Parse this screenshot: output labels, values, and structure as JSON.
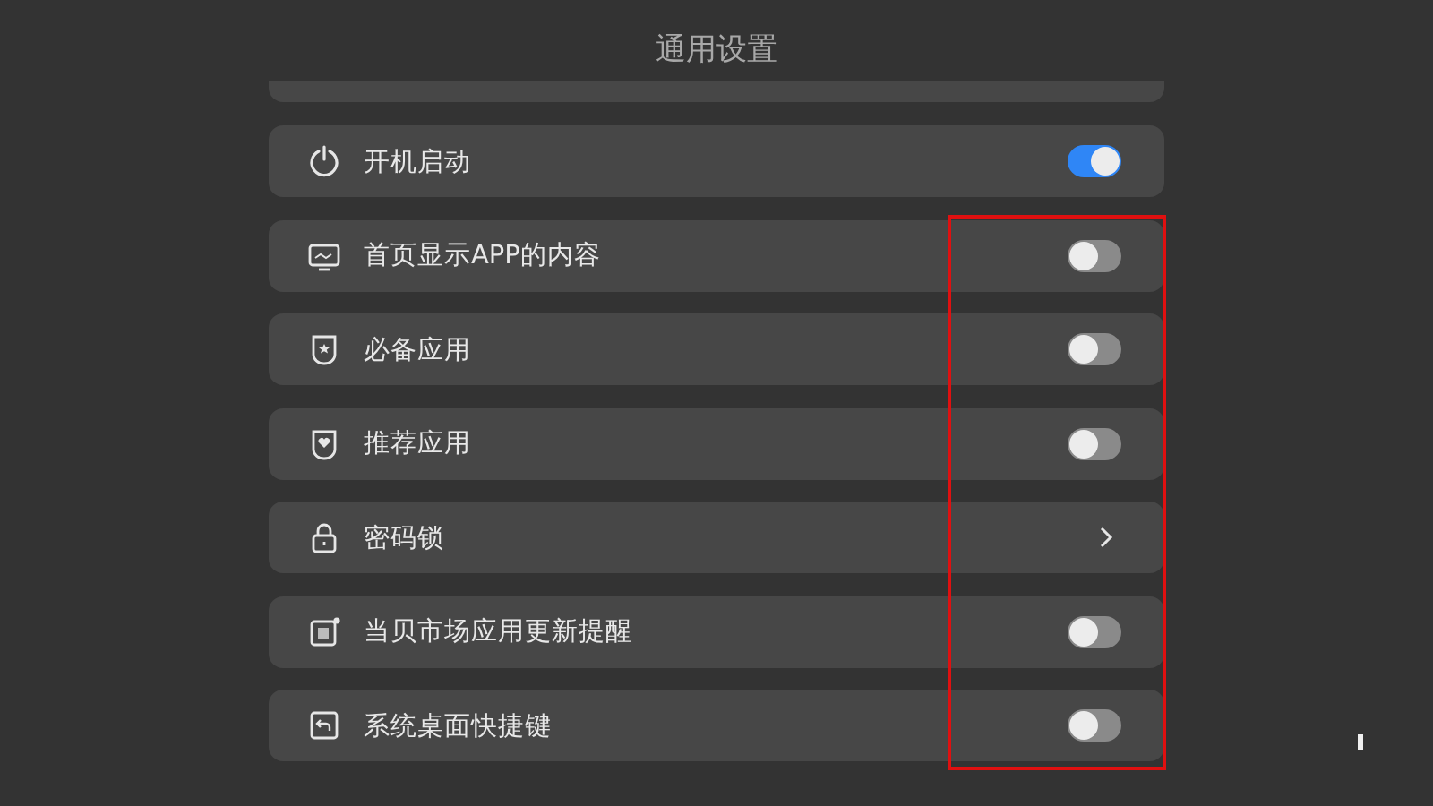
{
  "title": "通用设置",
  "items": [
    {
      "kind": "toggle",
      "label": "开机启动",
      "on": true
    },
    {
      "kind": "toggle",
      "label": "首页显示APP的内容",
      "on": false
    },
    {
      "kind": "toggle",
      "label": "必备应用",
      "on": false
    },
    {
      "kind": "toggle",
      "label": "推荐应用",
      "on": false
    },
    {
      "kind": "link",
      "label": "密码锁"
    },
    {
      "kind": "toggle",
      "label": "当贝市场应用更新提醒",
      "on": false
    },
    {
      "kind": "toggle",
      "label": "系统桌面快捷键",
      "on": false
    }
  ]
}
